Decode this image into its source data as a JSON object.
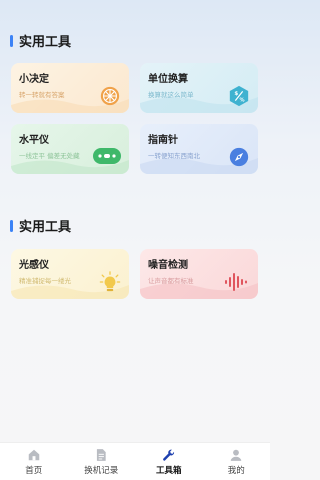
{
  "sections": [
    {
      "title": "实用工具"
    },
    {
      "title": "实用工具"
    }
  ],
  "tools": [
    {
      "title": "小决定",
      "subtitle": "转一转就有答案",
      "icon": "wheel-icon"
    },
    {
      "title": "单位换算",
      "subtitle": "换算就这么简单",
      "icon": "convert-icon"
    },
    {
      "title": "水平仪",
      "subtitle": "一线定平 偏差无处藏",
      "icon": "level-icon"
    },
    {
      "title": "指南针",
      "subtitle": "一转便知东西南北",
      "icon": "compass-icon"
    },
    {
      "title": "光感仪",
      "subtitle": "精准捕捉每一缕光",
      "icon": "bulb-icon"
    },
    {
      "title": "噪音检测",
      "subtitle": "让声音都有标准",
      "icon": "soundwave-icon"
    }
  ],
  "tabbar": [
    {
      "label": "首页",
      "icon": "home-icon",
      "active": false
    },
    {
      "label": "换机记录",
      "icon": "document-icon",
      "active": false
    },
    {
      "label": "工具箱",
      "icon": "wrench-icon",
      "active": true
    },
    {
      "label": "我的",
      "icon": "user-icon",
      "active": false
    }
  ],
  "colors": {
    "accent": "#3b82f6",
    "wheel": "#f0a24a",
    "convert": "#3fb2d0",
    "level": "#3fb86a",
    "compass": "#4a7fe0",
    "bulb": "#f2c94c",
    "soundwave": "#e0555e"
  }
}
